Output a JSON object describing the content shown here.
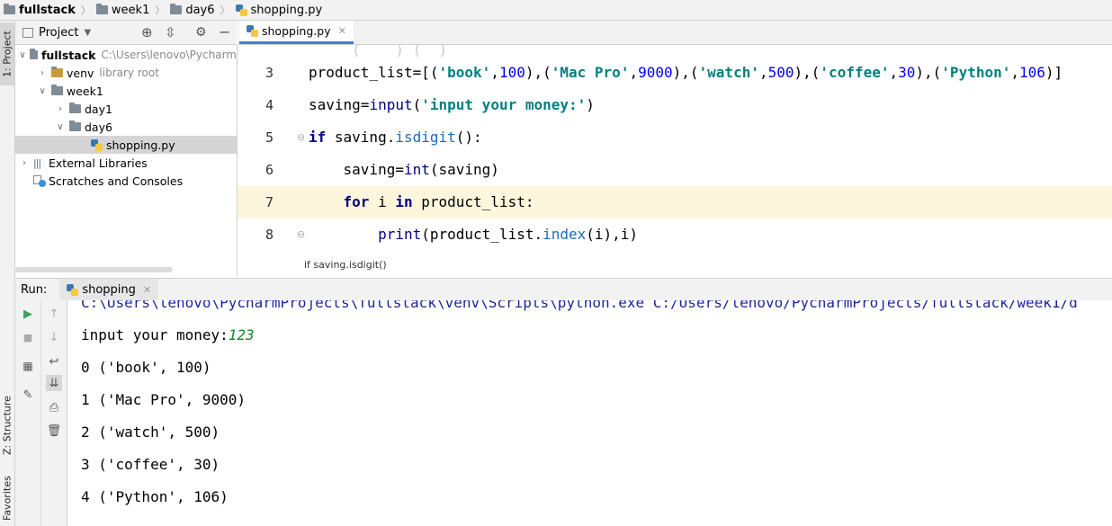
{
  "breadcrumb": {
    "project": "fullstack",
    "folder1": "week1",
    "folder2": "day6",
    "file": "shopping.py"
  },
  "left_stripe": {
    "project_tab": "1: Project",
    "structure_tab": "Z: Structure",
    "favorites_tab": "Favorites"
  },
  "project_panel": {
    "title": "Project",
    "tree": [
      {
        "label": "fullstack",
        "hint": "C:\\Users\\lenovo\\Pycharm"
      },
      {
        "label": "venv",
        "hint": "library root"
      },
      {
        "label": "week1",
        "hint": ""
      },
      {
        "label": "day1",
        "hint": ""
      },
      {
        "label": "day6",
        "hint": ""
      },
      {
        "label": "shopping.py",
        "hint": ""
      },
      {
        "label": "External Libraries",
        "hint": ""
      },
      {
        "label": "Scratches and Consoles",
        "hint": ""
      }
    ]
  },
  "editor": {
    "tab_label": "shopping.py",
    "line_numbers": [
      "3",
      "4",
      "5",
      "6",
      "7",
      "8"
    ],
    "breadcrumb_hint": "if saving.isdigit()"
  },
  "run": {
    "label": "Run:",
    "tab_label": "shopping",
    "console_lines": [
      "C:\\Users\\lenovo\\PycharmProjects\\fullstack\\venv\\Scripts\\python.exe C:/Users/lenovo/PycharmProjects/fullstack/week1/d",
      "input your money:",
      "0 ('book', 100)",
      "1 ('Mac Pro', 9000)",
      "2 ('watch', 500)",
      "3 ('coffee', 30)",
      "4 ('Python', 106)"
    ],
    "user_input": "123"
  },
  "colors": {
    "accent": "#4083c9",
    "highlight": "#fdf6dc"
  }
}
